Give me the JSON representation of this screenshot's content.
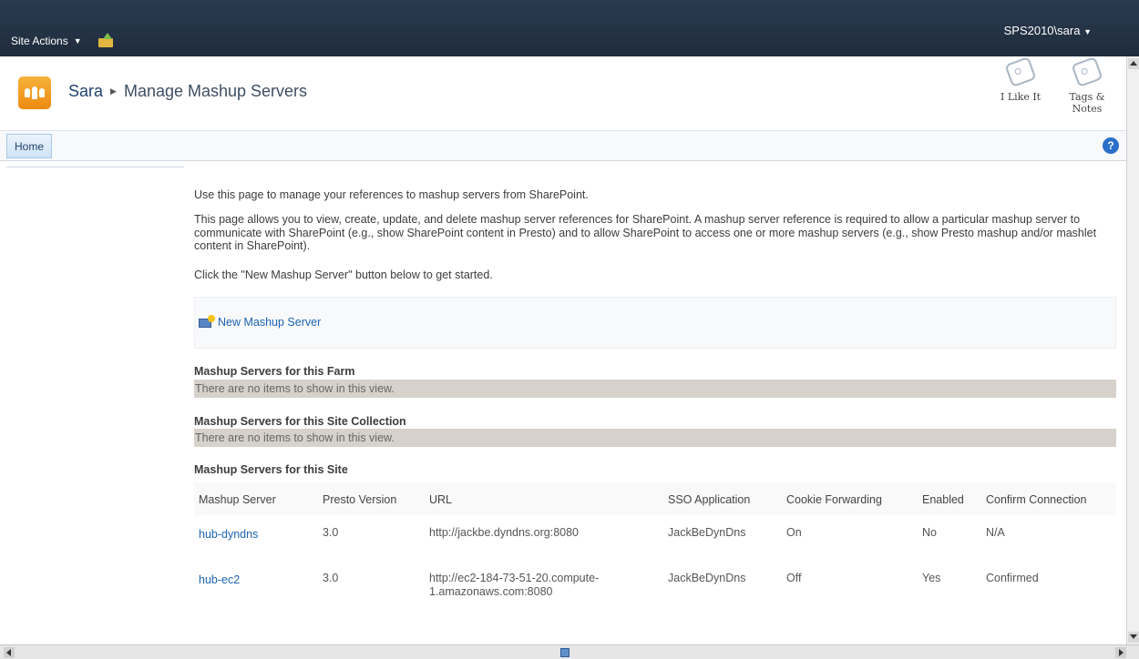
{
  "topbar": {
    "site_actions_label": "Site Actions",
    "user_label": "SPS2010\\sara"
  },
  "titlearea": {
    "breadcrumb_site": "Sara",
    "breadcrumb_page": "Manage Mashup Servers",
    "like_label": "I Like It",
    "tags_label": "Tags & Notes"
  },
  "linkbar": {
    "home_label": "Home"
  },
  "content": {
    "intro": "Use this page to manage your references to mashup servers from SharePoint.",
    "description": "This page allows you to view, create, update, and delete mashup server references for SharePoint. A mashup server reference is required to allow a particular mashup server to communicate with SharePoint (e.g., show SharePoint content in Presto) and to allow SharePoint to access one or more mashup servers (e.g., show Presto mashup and/or mashlet content in SharePoint).",
    "instructions": "Click the \"New Mashup Server\" button below to get started.",
    "new_server_label": "New Mashup Server"
  },
  "sections": {
    "farm_title": "Mashup Servers for this Farm",
    "farm_empty": "There are no items to show in this view.",
    "collection_title": "Mashup Servers for this Site Collection",
    "collection_empty": "There are no items to show in this view.",
    "site_title": "Mashup Servers for this Site"
  },
  "table": {
    "headers": [
      "Mashup Server",
      "Presto Version",
      "URL",
      "SSO Application",
      "Cookie Forwarding",
      "Enabled",
      "Confirm Connection"
    ],
    "rows": [
      [
        "hub-dyndns",
        "3.0",
        "http://jackbe.dyndns.org:8080",
        "JackBeDynDns",
        "On",
        "No",
        "N/A"
      ],
      [
        "hub-ec2",
        "3.0",
        "http://ec2-184-73-51-20.compute-1.amazonaws.com:8080",
        "JackBeDynDns",
        "Off",
        "Yes",
        "Confirmed"
      ]
    ]
  },
  "icons": {
    "help": "?"
  },
  "colors": {
    "topbar": "#1f2c3d",
    "link": "#1c63b3",
    "empty_row": "#d6d2cb",
    "logo": "#f0961c"
  }
}
